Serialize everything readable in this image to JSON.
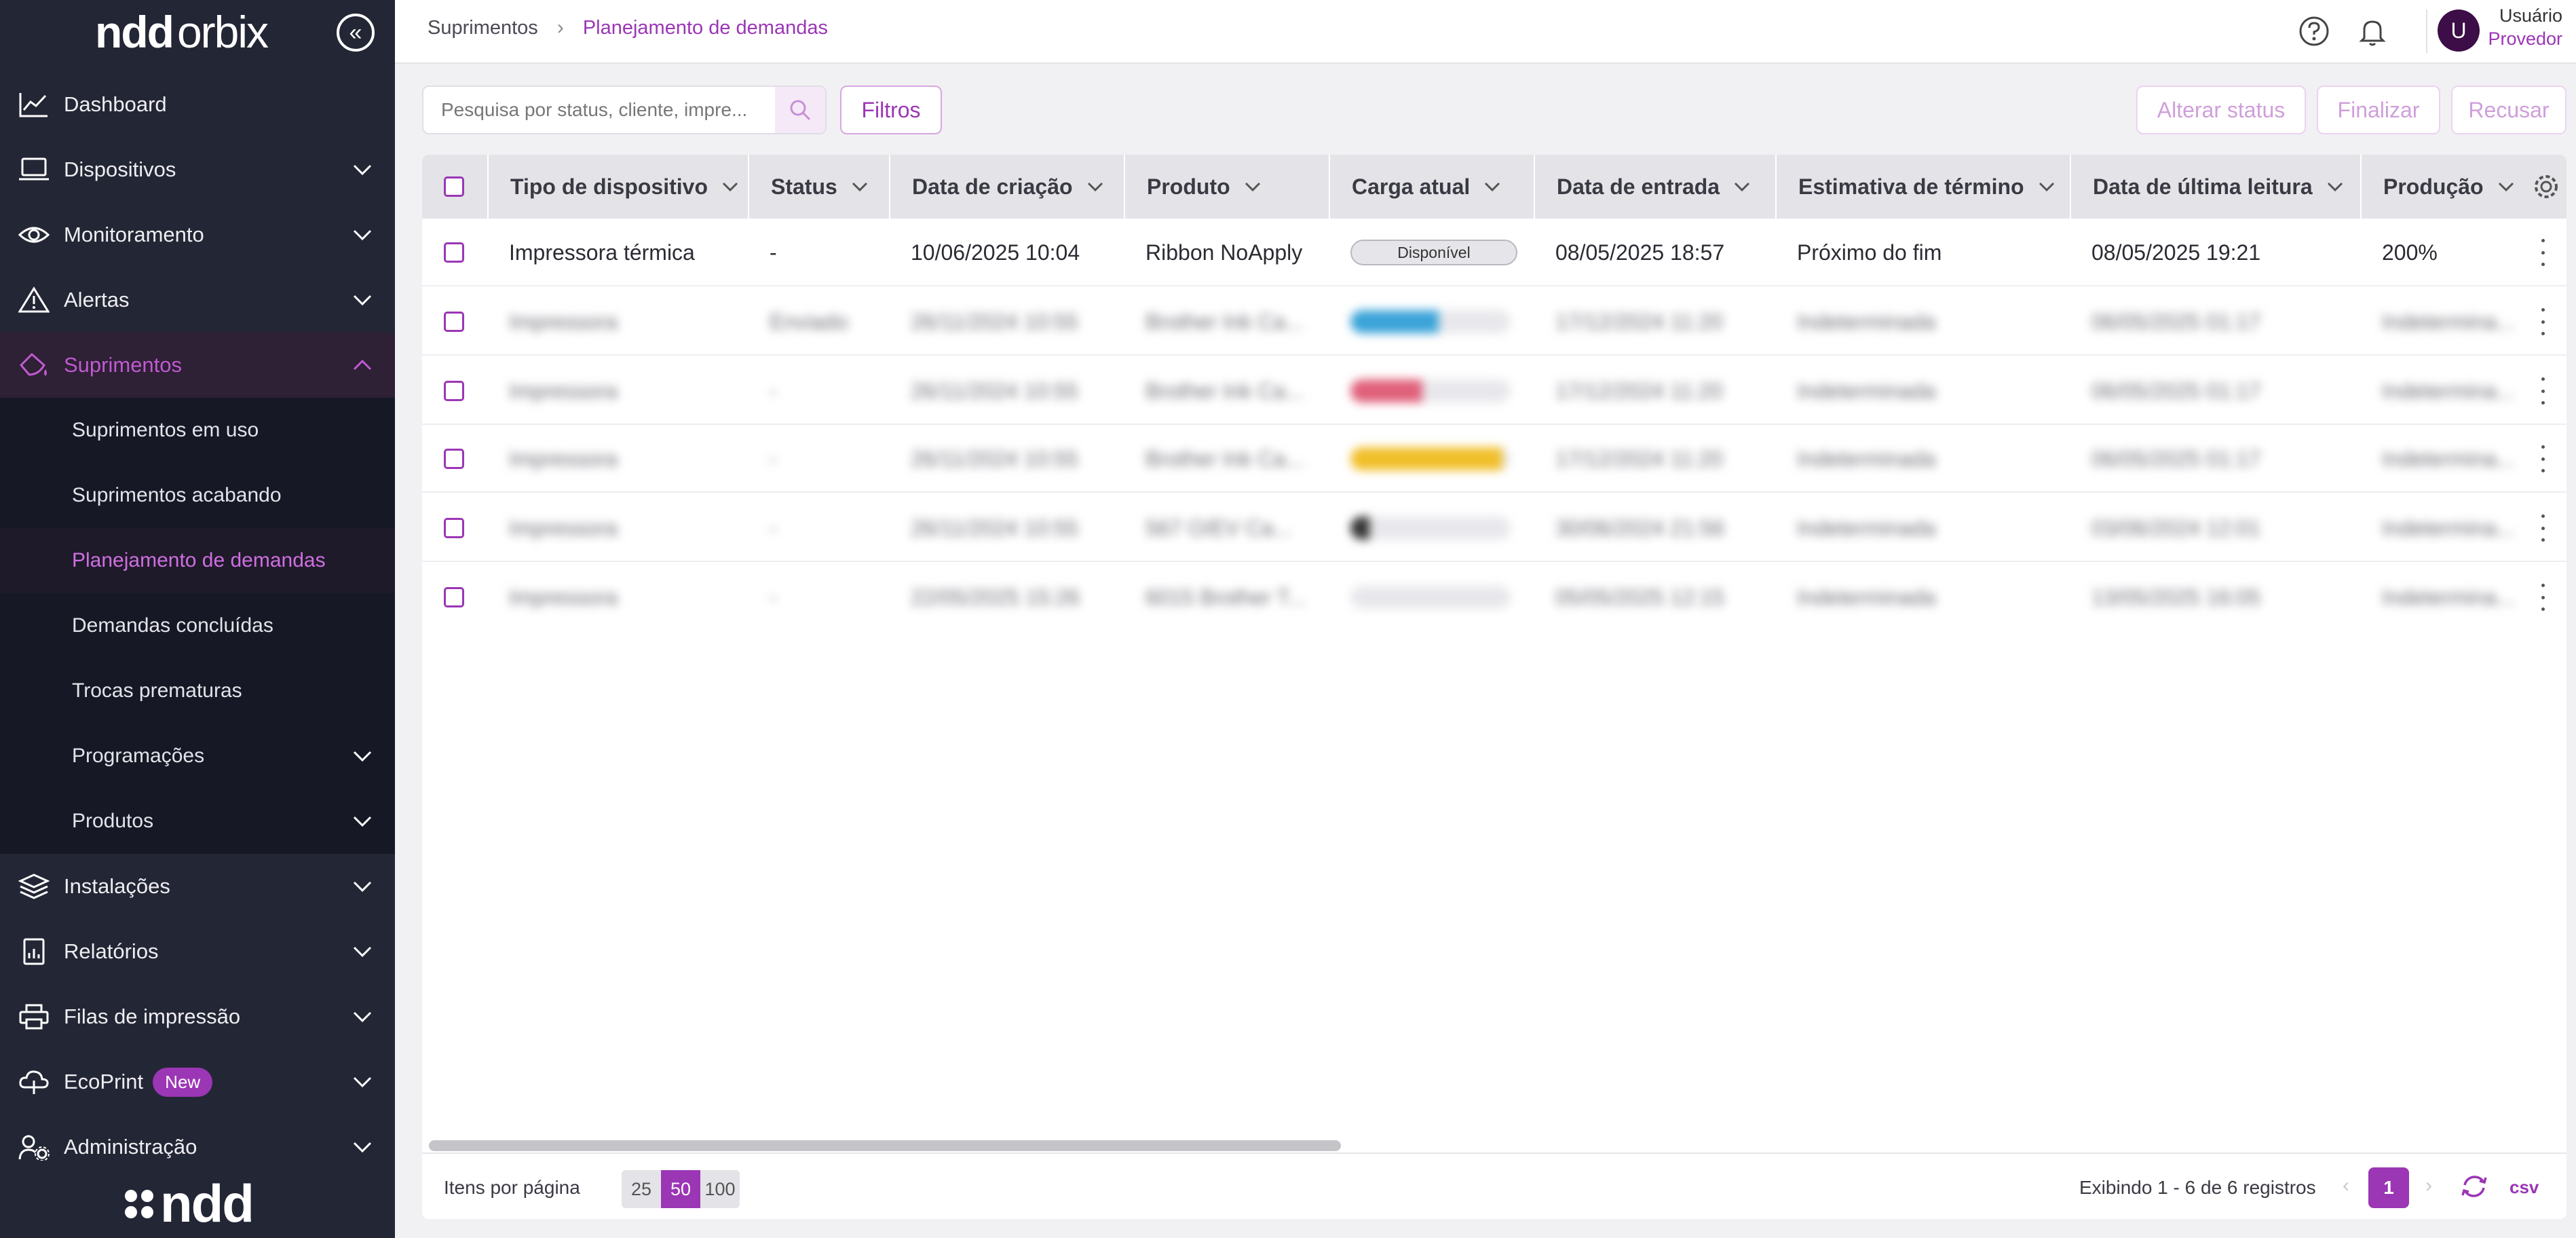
{
  "brand": {
    "logo_bold": "ndd",
    "logo_thin": "orbix",
    "footer_logo": "ndd"
  },
  "sidebar": {
    "items": [
      {
        "label": "Dashboard",
        "icon": "chart-line-icon"
      },
      {
        "label": "Dispositivos",
        "icon": "laptop-icon"
      },
      {
        "label": "Monitoramento",
        "icon": "eye-icon"
      },
      {
        "label": "Alertas",
        "icon": "warning-icon"
      },
      {
        "label": "Suprimentos",
        "icon": "ink-drop-icon"
      },
      {
        "label": "Instalações",
        "icon": "layers-icon"
      },
      {
        "label": "Relatórios",
        "icon": "report-icon"
      },
      {
        "label": "Filas de impressão",
        "icon": "printer-icon"
      },
      {
        "label": "EcoPrint",
        "icon": "cloud-leaf-icon",
        "badge": "New"
      },
      {
        "label": "Administração",
        "icon": "admin-gear-icon"
      }
    ],
    "sub_items": [
      {
        "label": "Suprimentos em uso"
      },
      {
        "label": "Suprimentos acabando"
      },
      {
        "label": "Planejamento de demandas"
      },
      {
        "label": "Demandas concluídas"
      },
      {
        "label": "Trocas prematuras"
      },
      {
        "label": "Programações"
      },
      {
        "label": "Produtos"
      }
    ]
  },
  "header": {
    "breadcrumb": [
      "Suprimentos",
      "Planejamento de demandas"
    ],
    "user_initial": "U",
    "user_name": "Usuário",
    "user_role": "Provedor"
  },
  "toolbar": {
    "search_placeholder": "Pesquisa por status, cliente, impre...",
    "filters_label": "Filtros",
    "change_status_label": "Alterar status",
    "finish_label": "Finalizar",
    "reject_label": "Recusar"
  },
  "table": {
    "columns": [
      "Tipo de dispositivo",
      "Status",
      "Data de criação",
      "Produto",
      "Carga atual",
      "Data de entrada",
      "Estimativa de término",
      "Data de última leitura",
      "Produção"
    ],
    "rows": [
      {
        "tipo": "Impressora térmica",
        "status": "-",
        "criacao": "10/06/2025 10:04",
        "produto": "Ribbon NoApply",
        "carga": "Disponível",
        "entrada": "08/05/2025 18:57",
        "estimativa": "Próximo do fim",
        "leitura": "08/05/2025 19:21",
        "producao": "200%"
      },
      {
        "tipo": "Impressora",
        "status": "Enviado",
        "criacao": "26/11/2024 10:55",
        "produto": "Brother Ink Ca...",
        "carga_level": 0.55,
        "carga_color": "#3aa3d8",
        "entrada": "17/12/2024 11:20",
        "estimativa": "Indeterminada",
        "leitura": "06/05/2025 01:17",
        "producao": "Indetermina..."
      },
      {
        "tipo": "Impressora",
        "status": "-",
        "criacao": "26/11/2024 10:55",
        "produto": "Brother Ink Ca...",
        "carga_level": 0.45,
        "carga_color": "#e0607a",
        "entrada": "17/12/2024 11:20",
        "estimativa": "Indeterminada",
        "leitura": "06/05/2025 01:17",
        "producao": "Indetermina..."
      },
      {
        "tipo": "Impressora",
        "status": "-",
        "criacao": "26/11/2024 10:55",
        "produto": "Brother Ink Ca...",
        "carga_level": 0.95,
        "carga_color": "#f1bf2a",
        "entrada": "17/12/2024 11:20",
        "estimativa": "Indeterminada",
        "leitura": "06/05/2025 01:17",
        "producao": "Indetermina..."
      },
      {
        "tipo": "Impressora",
        "status": "-",
        "criacao": "26/11/2024 10:55",
        "produto": "567 O/EV Ca...",
        "carga_level": 0.12,
        "carga_color": "#333333",
        "entrada": "30/06/2024 21:56",
        "estimativa": "Indeterminada",
        "leitura": "03/06/2024 12:01",
        "producao": "Indetermina..."
      },
      {
        "tipo": "Impressora",
        "status": "-",
        "criacao": "22/05/2025 15:26",
        "produto": "6015 Brother T...",
        "carga_level": 0.0,
        "carga_color": "#bbbbbb",
        "entrada": "05/05/2025 12:15",
        "estimativa": "Indeterminada",
        "leitura": "13/05/2025 16:05",
        "producao": "Indetermina..."
      }
    ]
  },
  "footer": {
    "per_page_label": "Itens por página",
    "page_sizes": [
      "25",
      "50",
      "100"
    ],
    "selected_page_size": "50",
    "showing_label": "Exibindo  1 - 6 de 6 registros",
    "current_page": "1",
    "export_label": "csv"
  },
  "colors": {
    "accent": "#9b36b5",
    "sidebar_bg": "#232634",
    "submenu_bg": "#161925"
  }
}
